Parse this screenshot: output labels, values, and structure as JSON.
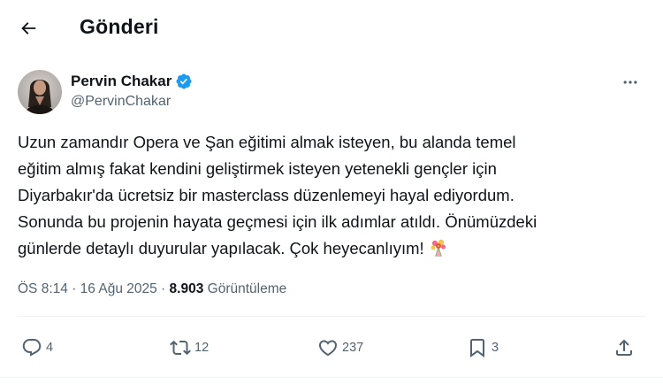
{
  "header": {
    "title": "Gönderi"
  },
  "author": {
    "name": "Pervin Chakar",
    "handle": "@PervinChakar",
    "verified": true
  },
  "tweet": {
    "lines": [
      "Uzun zamandır Opera ve Şan eğitimi almak isteyen, bu alanda temel",
      "eğitim almış fakat kendini geliştirmek isteyen yetenekli gençler için",
      "Diyarbakır'da ücretsiz bir masterclass düzenlemeyi hayal ediyordum.",
      "Sonunda bu projenin hayata geçmesi için ilk adımlar atıldı. Önümüzdeki",
      "günlerde detaylı duyurular yapılacak. Çok heyecanlıyım!"
    ],
    "emoji": "bouquet-emoji"
  },
  "meta": {
    "time": "ÖS 8:14",
    "separator": "·",
    "date": "16 Ağu 2025",
    "views_count": "8.903",
    "views_label": "Görüntüleme"
  },
  "actions": {
    "replies": "4",
    "retweets": "12",
    "likes": "237",
    "bookmarks": "3"
  },
  "icons": {
    "back": "arrow-left-icon",
    "verified": "verified-badge-icon",
    "more": "more-horizontal-icon",
    "reply": "reply-icon",
    "retweet": "retweet-icon",
    "like": "heart-icon",
    "bookmark": "bookmark-icon",
    "share": "share-icon"
  },
  "colors": {
    "text": "#0f1419",
    "secondary": "#536471",
    "verified": "#1d9bf0",
    "divider": "#eff3f4"
  }
}
